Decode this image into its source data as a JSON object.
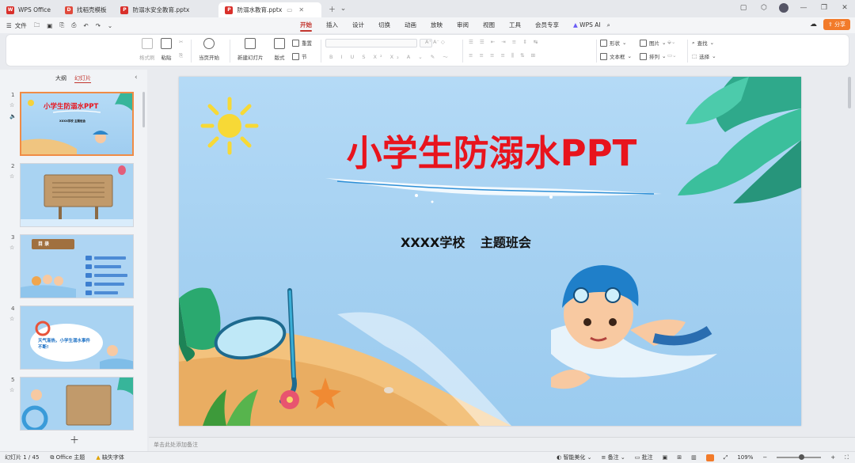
{
  "tabs": [
    {
      "label": "WPS Office",
      "icon": "wps-logo-icon",
      "color": "#d9302b"
    },
    {
      "label": "找稻壳模板",
      "icon": "docer-icon",
      "color": "#e04a3c"
    },
    {
      "label": "防溺水安全教育.pptx",
      "icon": "pptx-icon",
      "color": "#d9302b"
    },
    {
      "label": "防溺水教育.pptx",
      "icon": "pptx-icon",
      "color": "#d9302b",
      "active": true
    }
  ],
  "menu": {
    "file": "文件",
    "tabs": [
      "开始",
      "插入",
      "设计",
      "切换",
      "动画",
      "放映",
      "审阅",
      "视图",
      "工具",
      "会员专享"
    ],
    "wps_ai": "WPS AI",
    "share": "分享"
  },
  "ribbon": {
    "format_painter": "格式刷",
    "paste": "粘贴",
    "play_from_current": "当页开始",
    "new_slide": "新建幻灯片",
    "layout": "版式",
    "reset": "重置",
    "section": "节",
    "shape": "形状",
    "textbox": "文本框",
    "picture": "图片",
    "arrange": "排列",
    "find": "查找",
    "select": "选择"
  },
  "left_panel": {
    "tab_outline": "大纲",
    "tab_slides": "幻灯片",
    "thumbnails": [
      {
        "num": "1",
        "title": "小学生防溺水PPT",
        "sub": "XXXX学校   主题班会"
      },
      {
        "num": "2"
      },
      {
        "num": "3",
        "title": "目 录"
      },
      {
        "num": "4",
        "title": "天气渐热，小学生溺水事件不断!"
      },
      {
        "num": "5"
      }
    ]
  },
  "slide": {
    "title": "小学生防溺水PPT",
    "subtitle": "XXXX学校  主题班会",
    "notes_placeholder": "单击此处添加备注"
  },
  "status": {
    "slide_counter": "幻灯片 1 / 45",
    "theme": "Office 主题",
    "missing_font": "缺失字体",
    "smart_beautify": "智能美化",
    "notes": "备注",
    "comments": "批注",
    "zoom": "109%"
  },
  "colors": {
    "accent": "#c2352e",
    "title_red": "#e8141d",
    "share_orange": "#f27b2a"
  }
}
